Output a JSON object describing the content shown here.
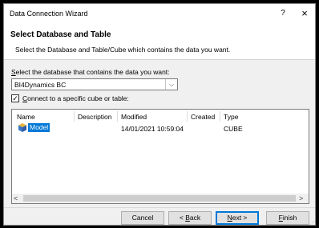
{
  "window": {
    "title": "Data Connection Wizard",
    "help": "?",
    "close": "×"
  },
  "header": {
    "title": "Select Database and Table",
    "subtitle": "Select the Database and Table/Cube which contains the data you want."
  },
  "database": {
    "label_prefix": "",
    "label_accel": "S",
    "label_rest": "elect the database that contains the data you want:",
    "selected": "BI4Dynamics BC",
    "arrow": "⌵"
  },
  "connect": {
    "checked": "✓",
    "label_accel": "C",
    "label_rest": "onnect to a specific cube or table:"
  },
  "table": {
    "columns": [
      "Name",
      "Description",
      "Modified",
      "Created",
      "Type"
    ],
    "rows": [
      {
        "name": "Model",
        "description": "",
        "modified": "14/01/2021 10:59:04",
        "created": "",
        "type": "CUBE"
      }
    ],
    "scroll_left": "<",
    "scroll_right": ">"
  },
  "buttons": {
    "cancel": "Cancel",
    "back_accel": "B",
    "back_prefix": "< ",
    "back_rest": "ack",
    "next_accel": "N",
    "next_rest": "ext >",
    "finish_accel": "F",
    "finish_rest": "inish"
  },
  "colors": {
    "selection": "#0078d7",
    "cube_icon_top": "#e8b53a",
    "cube_icon_left": "#3a76c8",
    "cube_icon_right": "#2f5ea3"
  }
}
